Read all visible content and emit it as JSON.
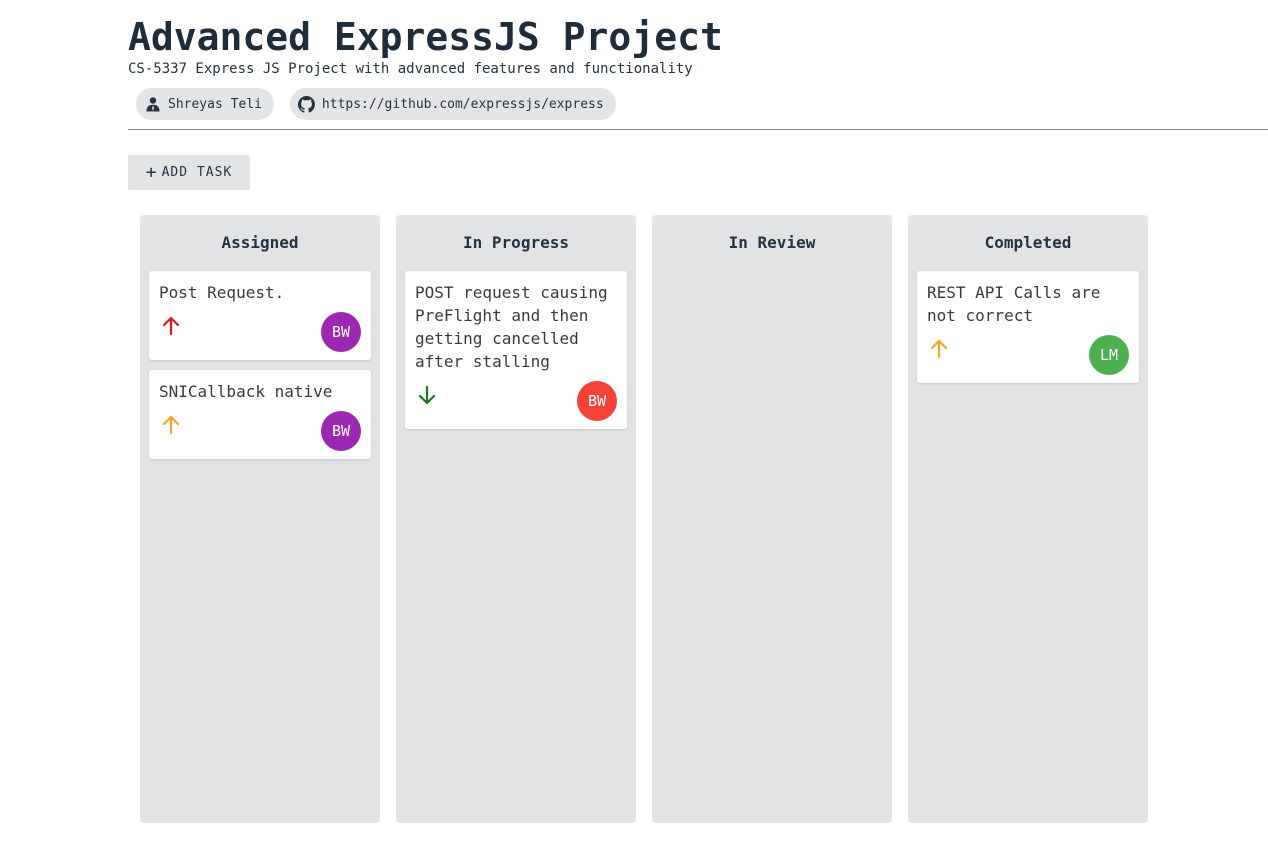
{
  "header": {
    "title": "Advanced ExpressJS Project",
    "subtitle": "CS-5337 Express JS Project with advanced features and functionality",
    "owner": "Shreyas Teli",
    "repo_url": "https://github.com/expressjs/express"
  },
  "toolbar": {
    "add_task_label": "ADD TASK"
  },
  "columns": [
    {
      "title": "Assigned",
      "cards": [
        {
          "text": "Post Request.",
          "priority_icon": "arrow-up-icon",
          "priority_color": "#e01b1b",
          "assignee": "BW",
          "avatar_color": "#9c27b0"
        },
        {
          "text": "SNICallback native",
          "priority_icon": "arrow-up-icon",
          "priority_color": "#f5a623",
          "assignee": "BW",
          "avatar_color": "#9c27b0"
        }
      ]
    },
    {
      "title": "In Progress",
      "cards": [
        {
          "text": "POST request causing PreFlight and then getting cancelled after stalling",
          "priority_icon": "arrow-down-icon",
          "priority_color": "#1b7a1b",
          "assignee": "BW",
          "avatar_color": "#f44336"
        }
      ]
    },
    {
      "title": "In Review",
      "cards": []
    },
    {
      "title": "Completed",
      "cards": [
        {
          "text": "REST API Calls are not correct",
          "priority_icon": "arrow-up-icon",
          "priority_color": "#f5a623",
          "assignee": "LM",
          "avatar_color": "#4caf50"
        }
      ]
    }
  ]
}
